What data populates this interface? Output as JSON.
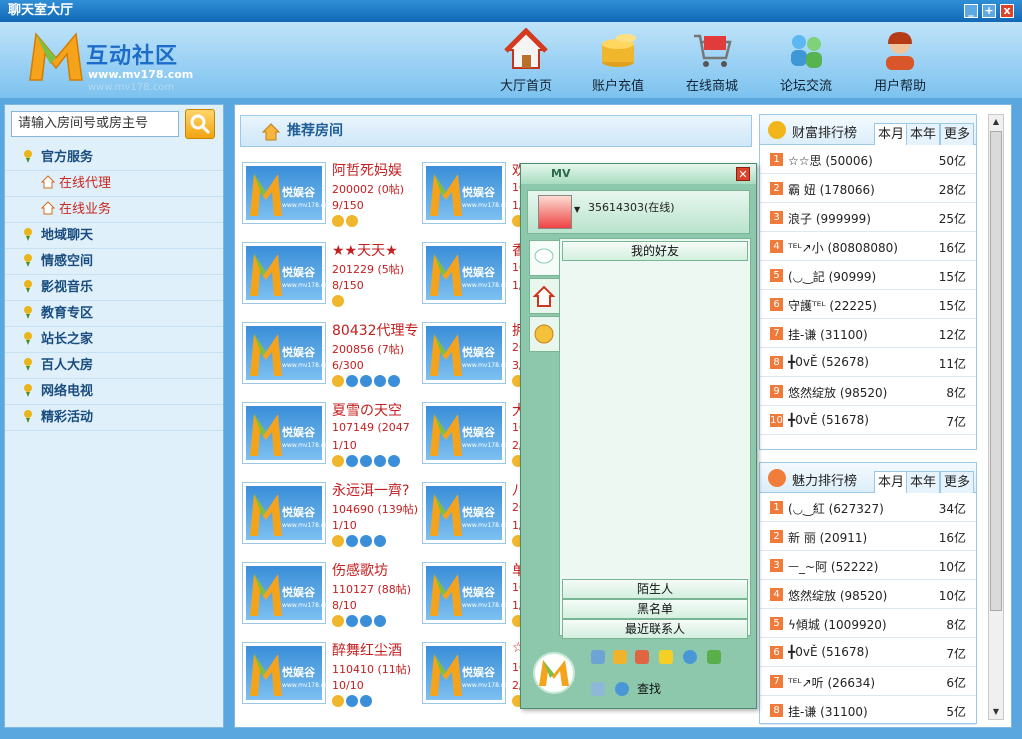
{
  "window": {
    "title": "聊天室大厅",
    "buttons": [
      "_",
      "+",
      "x"
    ]
  },
  "header": {
    "logo_text": "互动社区",
    "logo_url": "www.mv178.com",
    "logo_shadow": "www.mv178.com",
    "nav": [
      {
        "label": "大厅首页",
        "icon": "home-icon"
      },
      {
        "label": "账户充值",
        "icon": "coins-icon"
      },
      {
        "label": "在线商城",
        "icon": "shopping-cart-icon"
      },
      {
        "label": "论坛交流",
        "icon": "forum-people-icon"
      },
      {
        "label": "用户帮助",
        "icon": "support-agent-icon"
      }
    ]
  },
  "sidebar": {
    "search_placeholder": "请输入房间号或房主号",
    "items": [
      {
        "label": "官方服务",
        "children": [
          "在线代理",
          "在线业务"
        ]
      },
      {
        "label": "地域聊天"
      },
      {
        "label": "情感空间"
      },
      {
        "label": "影视音乐"
      },
      {
        "label": "教育专区"
      },
      {
        "label": "站长之家"
      },
      {
        "label": "百人大房"
      },
      {
        "label": "网络电视"
      },
      {
        "label": "精彩活动"
      }
    ]
  },
  "main": {
    "section_title": "推荐房间",
    "thumb_label": "悦娱谷",
    "thumb_url": "www.mv178.com",
    "rooms_left": [
      {
        "name": "阿哲死妈娱",
        "id": "200002 (0帖)",
        "count": "9/150",
        "badges": 2
      },
      {
        "name": "★★天天★",
        "id": "201229 (5帖)",
        "count": "8/150",
        "badges": 1
      },
      {
        "name": "80432代理专",
        "id": "200856 (7帖)",
        "count": "6/300",
        "badges": 5
      },
      {
        "name": "夏雪の天空",
        "id": "107149 (2047",
        "count": "1/10",
        "badges": 5
      },
      {
        "name": "永远洱一齊?",
        "id": "104690 (139帖)",
        "count": "1/10",
        "badges": 4
      },
      {
        "name": "伤感歌坊",
        "id": "110127 (88帖)",
        "count": "8/10",
        "badges": 4
      },
      {
        "name": "醉舞红尘酒",
        "id": "110410 (11帖)",
        "count": "10/10",
        "badges": 3
      }
    ],
    "rooms_right": [
      {
        "name": "欢",
        "id": "10",
        "count": "1/",
        "badges": 1
      },
      {
        "name": "香",
        "id": "10",
        "count": "1/",
        "badges": 0
      },
      {
        "name": "拥",
        "id": "20",
        "count": "3/",
        "badges": 1
      },
      {
        "name": "大",
        "id": "10",
        "count": "2/",
        "badges": 1
      },
      {
        "name": "八",
        "id": "20",
        "count": "1/",
        "badges": 1
      },
      {
        "name": "单",
        "id": "10",
        "count": "1/",
        "badges": 1
      },
      {
        "name": "☆",
        "id": "10",
        "count": "2/",
        "badges": 1
      }
    ]
  },
  "wealth_rank": {
    "title": "财富排行榜",
    "tabs": [
      "本月",
      "本年",
      "更多"
    ],
    "rows": [
      {
        "rank": "1",
        "name": "☆☆思 (50006)",
        "amount": "50亿"
      },
      {
        "rank": "2",
        "name": "霸 妞 (178066)",
        "amount": "28亿"
      },
      {
        "rank": "3",
        "name": "浪子 (999999)",
        "amount": "25亿"
      },
      {
        "rank": "4",
        "name": "ᵀᴱᴸ↗小 (80808080)",
        "amount": "16亿"
      },
      {
        "rank": "5",
        "name": "(◡‿記 (90999)",
        "amount": "15亿"
      },
      {
        "rank": "6",
        "name": "守護ᵀᴱᴸ (22225)",
        "amount": "15亿"
      },
      {
        "rank": "7",
        "name": "挂-谦 (31100)",
        "amount": "12亿"
      },
      {
        "rank": "8",
        "name": "╋0vĚ (52678)",
        "amount": "11亿"
      },
      {
        "rank": "9",
        "name": "悠然绽放 (98520)",
        "amount": "8亿"
      },
      {
        "rank": "10",
        "name": "╋0vĚ (51678)",
        "amount": "7亿"
      }
    ]
  },
  "charm_rank": {
    "title": "魅力排行榜",
    "tabs": [
      "本月",
      "本年",
      "更多"
    ],
    "rows": [
      {
        "rank": "1",
        "name": "(◡‿紅 (627327)",
        "amount": "34亿"
      },
      {
        "rank": "2",
        "name": "新 丽 (20911)",
        "amount": "16亿"
      },
      {
        "rank": "3",
        "name": "ᅳ_~阿 (52222)",
        "amount": "10亿"
      },
      {
        "rank": "4",
        "name": "悠然绽放 (98520)",
        "amount": "10亿"
      },
      {
        "rank": "5",
        "name": "ϟ傾城 (1009920)",
        "amount": "8亿"
      },
      {
        "rank": "6",
        "name": "╋0vĚ (51678)",
        "amount": "7亿"
      },
      {
        "rank": "7",
        "name": "ᵀᴱᴸ↗听 (26634)",
        "amount": "6亿"
      },
      {
        "rank": "8",
        "name": "挂-谦 (31100)",
        "amount": "5亿"
      }
    ]
  },
  "friend_popup": {
    "title_text": "MV",
    "user": "35614303(在线)",
    "groups_top": [
      "我的好友"
    ],
    "groups_bottom": [
      "陌生人",
      "黑名单",
      "最近联系人"
    ],
    "tools": [
      "pin-icon",
      "medal-icon",
      "notepad-icon",
      "star-icon",
      "chat-icon",
      "clover-icon"
    ],
    "find_label": "查找"
  },
  "colors": {
    "accent": "#1268b5",
    "room_text": "#c41e1e",
    "rank_num": "#f07a3a",
    "popup_bg": "#8dc8ad"
  }
}
